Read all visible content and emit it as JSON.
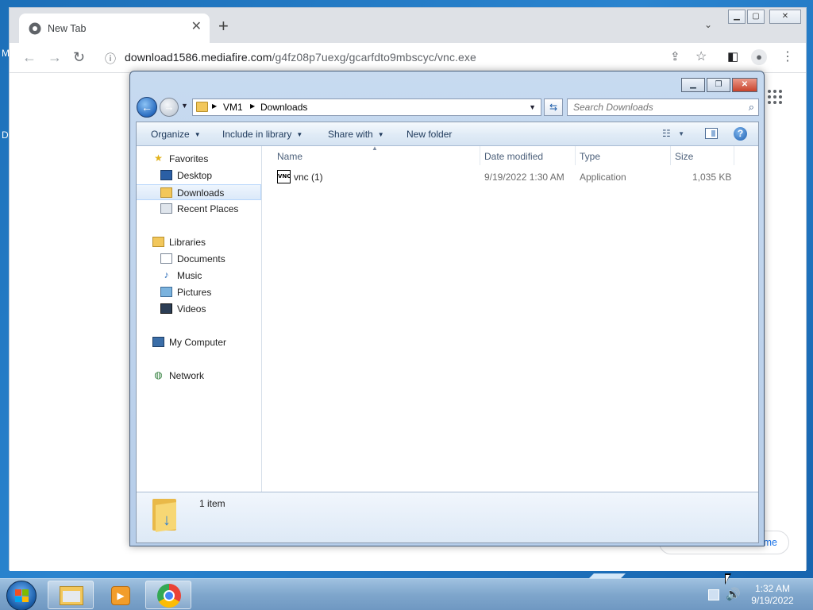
{
  "browser": {
    "tab_title": "New Tab",
    "tab_close": "✕",
    "new_tab": "+",
    "url_host": "download1586.mediafire.com",
    "url_path": "/g4fz08p7uexg/gcarfdto9mbscyc/vnc.exe",
    "bottom_pill_text": "me",
    "icons": [
      "chrome-logo-icon",
      "back-arrow-icon",
      "forward-arrow-icon",
      "reload-icon",
      "site-info-icon",
      "share-icon",
      "bookmark-star-icon",
      "side-panel-icon",
      "profile-icon",
      "kebab-menu-icon",
      "apps-grid-icon"
    ]
  },
  "desktop": {
    "edge_glyph_1": "M",
    "edge_glyph_2": "D"
  },
  "explorer": {
    "breadcrumb": [
      "VM1",
      "Downloads"
    ],
    "search_placeholder": "Search Downloads",
    "commands": {
      "organize": "Organize",
      "include_in_library": "Include in library",
      "share_with": "Share with",
      "new_folder": "New folder"
    },
    "nav": {
      "favorites": "Favorites",
      "desktop": "Desktop",
      "downloads": "Downloads",
      "recent_places": "Recent Places",
      "libraries": "Libraries",
      "documents": "Documents",
      "music": "Music",
      "pictures": "Pictures",
      "videos": "Videos",
      "my_computer": "My Computer",
      "network": "Network"
    },
    "columns": {
      "name": "Name",
      "date_modified": "Date modified",
      "type": "Type",
      "size": "Size"
    },
    "files": [
      {
        "name": "vnc (1)",
        "date_modified": "9/19/2022 1:30 AM",
        "type": "Application",
        "size": "1,035 KB",
        "icon_text": "VNC"
      }
    ],
    "item_count": "1 item"
  },
  "taskbar": {
    "time": "1:32 AM",
    "date": "9/19/2022"
  }
}
